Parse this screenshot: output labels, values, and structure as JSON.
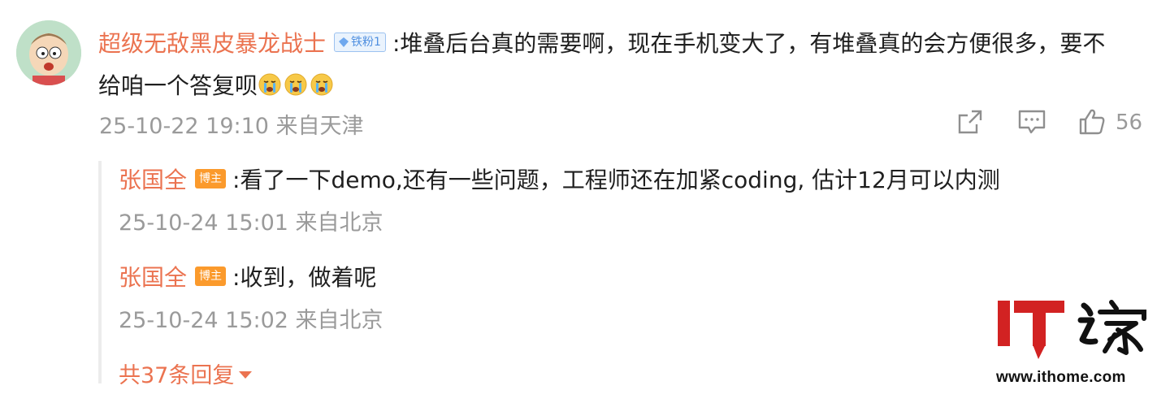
{
  "comment": {
    "nickname": "超级无敌黑皮暴龙战士",
    "fan_badge": "铁粉1",
    "text": "堆叠后台真的需要啊，现在手机变大了，有堆叠真的会方便很多，要不给咱一个答复呗",
    "emoji": "crying-face",
    "timestamp": "25-10-22 19:10",
    "location": "来自天津",
    "like_count": "56"
  },
  "replies": [
    {
      "nickname": "张国全",
      "badge": "博主",
      "text": "看了一下demo,还有一些问题，工程师还在加紧coding, 估计12月可以内测",
      "timestamp": "25-10-24 15:01",
      "location": "来自北京"
    },
    {
      "nickname": "张国全",
      "badge": "博主",
      "text": "收到，做着呢",
      "timestamp": "25-10-24 15:02",
      "location": "来自北京"
    }
  ],
  "more_replies": "共37条回复",
  "watermark": {
    "logo_text": "IT之家",
    "url": "www.ithome.com"
  },
  "colors": {
    "nickname": "#eb7350",
    "meta": "#9a9a9a",
    "host_badge": "#fb9a2c",
    "logo_red": "#d22222"
  }
}
